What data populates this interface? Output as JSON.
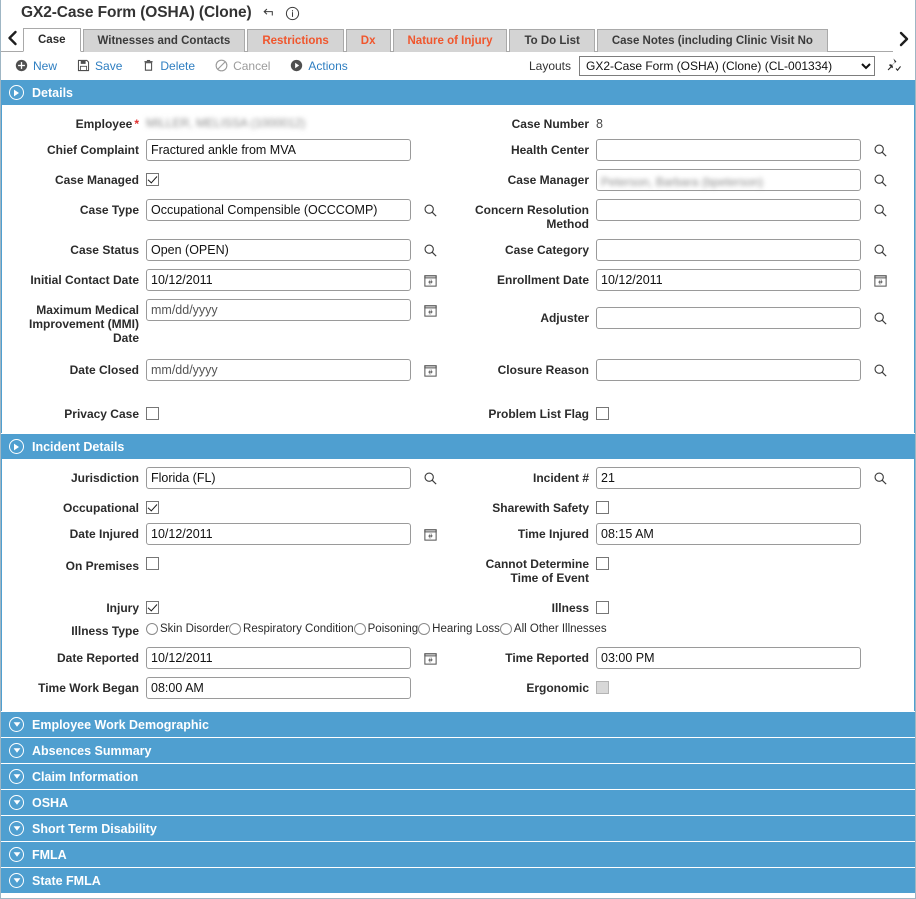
{
  "window": {
    "title": "GX2-Case Form (OSHA) (Clone)",
    "refresh_icon": "undo-arrow-icon",
    "info_icon": "info-circle-icon"
  },
  "tabs": {
    "prev_label": "‹",
    "next_label": "›",
    "items": [
      {
        "label": "Case",
        "active": true,
        "accent": false
      },
      {
        "label": "Witnesses and Contacts",
        "active": false,
        "accent": false
      },
      {
        "label": "Restrictions",
        "active": false,
        "accent": true
      },
      {
        "label": "Dx",
        "active": false,
        "accent": true
      },
      {
        "label": "Nature of Injury",
        "active": false,
        "accent": true
      },
      {
        "label": "To Do List",
        "active": false,
        "accent": false
      },
      {
        "label": "Case Notes (including Clinic Visit No",
        "active": false,
        "accent": false
      }
    ]
  },
  "toolbar": {
    "new_label": "New",
    "save_label": "Save",
    "delete_label": "Delete",
    "cancel_label": "Cancel",
    "actions_label": "Actions",
    "layouts_label": "Layouts",
    "layout_selected": "GX2-Case Form (OSHA) (Clone) (CL-001334)",
    "pin_icon": "pin-check-icon"
  },
  "details": {
    "header": "Details",
    "left": {
      "employee_label": "Employee",
      "employee_required": "*",
      "employee_value": "MILLER, MELISSA (1000012)",
      "chief_complaint_label": "Chief Complaint",
      "chief_complaint_value": "Fractured ankle from MVA",
      "case_managed_label": "Case Managed",
      "case_managed_checked": true,
      "case_type_label": "Case Type",
      "case_type_value": "Occupational Compensible (OCCCOMP)",
      "case_status_label": "Case Status",
      "case_status_value": "Open (OPEN)",
      "initial_contact_date_label": "Initial Contact Date",
      "initial_contact_date_value": "10/12/2011",
      "mmi_date_label": "Maximum Medical Improvement (MMI) Date",
      "mmi_date_placeholder": "mm/dd/yyyy",
      "date_closed_label": "Date Closed",
      "date_closed_placeholder": "mm/dd/yyyy",
      "privacy_case_label": "Privacy Case",
      "privacy_case_checked": false
    },
    "right": {
      "case_number_label": "Case Number",
      "case_number_value": "8",
      "health_center_label": "Health Center",
      "health_center_value": "",
      "case_manager_label": "Case Manager",
      "case_manager_value": "Peterson, Barbara (bpeterson)",
      "concern_resolution_label": "Concern Resolution Method",
      "concern_resolution_value": "",
      "case_category_label": "Case Category",
      "case_category_value": "",
      "enrollment_date_label": "Enrollment Date",
      "enrollment_date_value": "10/12/2011",
      "adjuster_label": "Adjuster",
      "adjuster_value": "",
      "closure_reason_label": "Closure Reason",
      "closure_reason_value": "",
      "problem_list_flag_label": "Problem List Flag",
      "problem_list_flag_checked": false
    }
  },
  "incident": {
    "header": "Incident Details",
    "left": {
      "jurisdiction_label": "Jurisdiction",
      "jurisdiction_value": "Florida (FL)",
      "occupational_label": "Occupational",
      "occupational_checked": true,
      "date_injured_label": "Date Injured",
      "date_injured_value": "10/12/2011",
      "on_premises_label": "On Premises",
      "on_premises_checked": false,
      "injury_label": "Injury",
      "injury_checked": true,
      "illness_type_label": "Illness Type",
      "date_reported_label": "Date Reported",
      "date_reported_value": "10/12/2011",
      "time_work_began_label": "Time Work Began",
      "time_work_began_value": "08:00 AM"
    },
    "right": {
      "incident_number_label": "Incident #",
      "incident_number_value": "21",
      "sharewith_safety_label": "Sharewith Safety",
      "sharewith_safety_checked": false,
      "time_injured_label": "Time Injured",
      "time_injured_value": "08:15 AM",
      "cannot_determine_label": "Cannot Determine Time of Event",
      "cannot_determine_checked": false,
      "illness_label": "Illness",
      "illness_checked": false,
      "time_reported_label": "Time Reported",
      "time_reported_value": "03:00 PM",
      "ergonomic_label": "Ergonomic",
      "ergonomic_checked": false,
      "ergonomic_disabled": true
    },
    "illness_types": [
      {
        "label": "Skin Disorder",
        "selected": false
      },
      {
        "label": "Respiratory Condition",
        "selected": false
      },
      {
        "label": "Poisoning",
        "selected": false
      },
      {
        "label": "Hearing Loss",
        "selected": false
      },
      {
        "label": "All Other Illnesses",
        "selected": false
      }
    ]
  },
  "collapsed_sections": [
    {
      "label": "Employee Work Demographic"
    },
    {
      "label": "Absences Summary"
    },
    {
      "label": "Claim Information"
    },
    {
      "label": "OSHA"
    },
    {
      "label": "Short Term Disability"
    },
    {
      "label": "FMLA"
    },
    {
      "label": "State FMLA"
    }
  ],
  "colors": {
    "section_blue": "#4f9fd0",
    "accent_orange": "#f0562d",
    "link_blue": "#2e7ec1",
    "required_red": "#e03131"
  }
}
